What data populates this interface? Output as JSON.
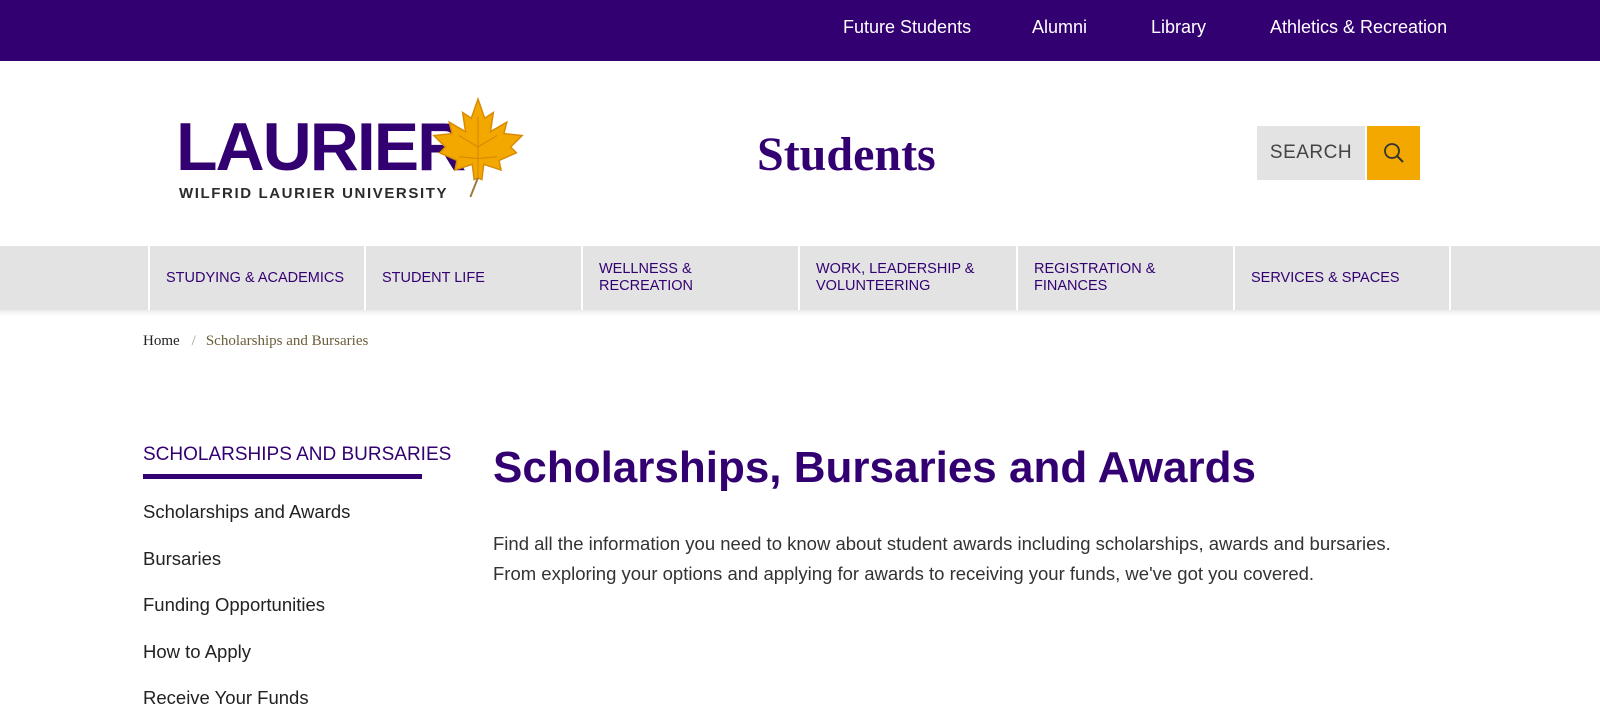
{
  "topbar": {
    "links": [
      {
        "label": "Future Students"
      },
      {
        "label": "Alumni"
      },
      {
        "label": "Library"
      },
      {
        "label": "Athletics & Recreation"
      }
    ]
  },
  "header": {
    "logo": {
      "wordmark": "LAURIER",
      "subtitle": "WILFRID LAURIER UNIVERSITY",
      "icon": "maple-leaf-icon",
      "leaf_color": "#f3a800"
    },
    "site_title": "Students",
    "search": {
      "label": "SEARCH",
      "icon": "search-icon"
    }
  },
  "main_nav": {
    "items": [
      {
        "label": "STUDYING & ACADEMICS"
      },
      {
        "label": "STUDENT LIFE"
      },
      {
        "label": "WELLNESS & RECREATION"
      },
      {
        "label": "WORK, LEADERSHIP & VOLUNTEERING"
      },
      {
        "label": "REGISTRATION & FINANCES"
      },
      {
        "label": "SERVICES & SPACES"
      }
    ]
  },
  "breadcrumb": {
    "home": "Home",
    "separator": "/",
    "current": "Scholarships and Bursaries"
  },
  "sidebar": {
    "heading": "SCHOLARSHIPS AND BURSARIES",
    "items": [
      {
        "label": "Scholarships and Awards"
      },
      {
        "label": "Bursaries"
      },
      {
        "label": "Funding Opportunities"
      },
      {
        "label": "How to Apply"
      },
      {
        "label": "Receive Your Funds"
      }
    ]
  },
  "content": {
    "title": "Scholarships, Bursaries and Awards",
    "intro": "Find all the information you need to know about student awards including scholarships, awards and bursaries. From exploring your options and applying for awards to receiving your funds, we've got you covered."
  },
  "colors": {
    "brand_purple": "#330072",
    "accent_gold": "#f3a800",
    "nav_gray": "#e3e3e3"
  }
}
